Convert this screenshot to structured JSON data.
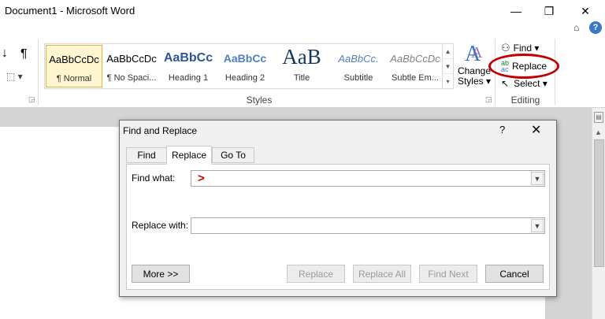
{
  "window": {
    "title": "Document1  -  Microsoft Word",
    "minimize_glyph": "—",
    "restore_glyph": "❐",
    "close_glyph": "✕"
  },
  "help_row": {
    "collapse_glyph": "⌂",
    "help_glyph": "?"
  },
  "paragraph_group": {
    "sort_glyph": "↓",
    "pilcrow_glyph": "¶",
    "borders_glyph": "⬚ ▾"
  },
  "styles": {
    "group_label": "Styles",
    "items": [
      {
        "preview": "AaBbCcDc",
        "name": "¶ Normal"
      },
      {
        "preview": "AaBbCcDc",
        "name": "¶ No Spaci..."
      },
      {
        "preview": "AaBbCc",
        "name": "Heading 1"
      },
      {
        "preview": "AaBbCc",
        "name": "Heading 2"
      },
      {
        "preview": "AaB",
        "name": "Title"
      },
      {
        "preview": "AaBbCc.",
        "name": "Subtitle"
      },
      {
        "preview": "AaBbCcDc",
        "name": "Subtle Em..."
      }
    ],
    "change_styles": {
      "line1": "Change",
      "line2": "Styles ▾"
    }
  },
  "editing": {
    "group_label": "Editing",
    "find_label": "Find ▾",
    "replace_label": "Replace",
    "select_label": "Select ▾"
  },
  "dialog": {
    "title": "Find and Replace",
    "help": "?",
    "close": "✕",
    "tabs": [
      "Find",
      "Replace",
      "Go To"
    ],
    "active_tab": "Replace",
    "find_what_label": "Find what:",
    "find_what_value": ">",
    "replace_with_label": "Replace with:",
    "replace_with_value": "",
    "buttons": {
      "more": "More >>",
      "replace": "Replace",
      "replace_all": "Replace All",
      "find_next": "Find Next",
      "cancel": "Cancel"
    }
  },
  "colors": {
    "annotation_red": "#c00000",
    "heading_blue": "#2f5597",
    "title_navy": "#17365d",
    "accent_blue": "#3a78c4"
  }
}
